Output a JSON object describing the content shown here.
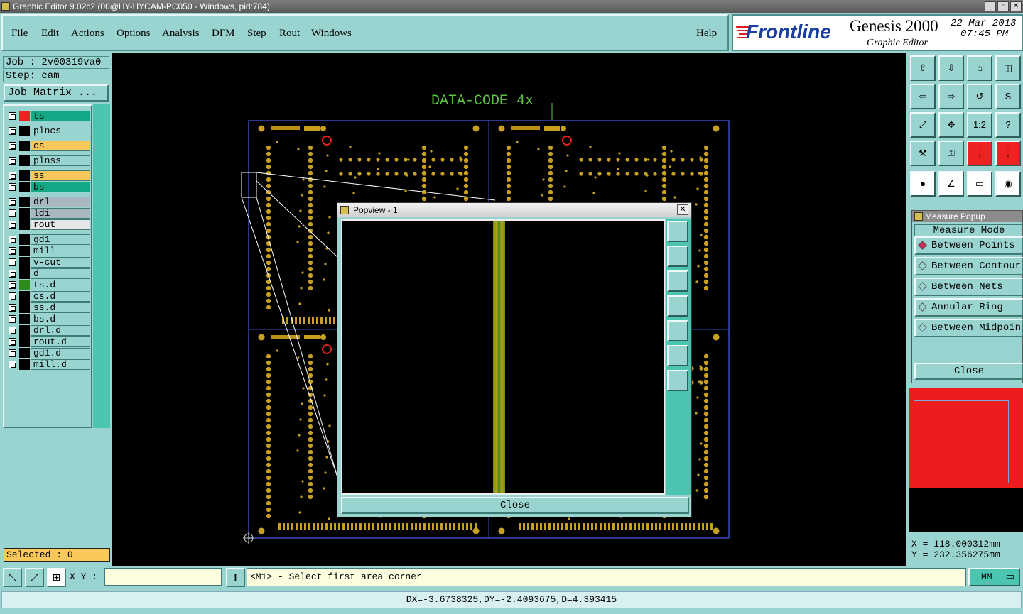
{
  "window": {
    "title": "Graphic Editor 9.02c2 (00@HY-HYCAM-PC050 - Windows, pid:784)"
  },
  "menu": [
    "File",
    "Edit",
    "Actions",
    "Options",
    "Analysis",
    "DFM",
    "Step",
    "Rout",
    "Windows"
  ],
  "help_label": "Help",
  "brand": {
    "logo": "Frontline",
    "product": "Genesis 2000",
    "subtitle": "Graphic Editor",
    "date": "22 Mar 2013",
    "time": "07:45 PM"
  },
  "job": {
    "job_line": "Job : 2v00319va0",
    "step_line": "Step: cam",
    "matrix_button": "Job Matrix ..."
  },
  "layers": [
    {
      "name": "ts",
      "color": "#13a886",
      "swatch": "#ee2222"
    },
    {
      "name": "plncs",
      "color": "#9ad4d0",
      "swatch": "#000000"
    },
    {
      "name": "cs",
      "color": "#f8c85a",
      "swatch": "#000000"
    },
    {
      "name": "plnss",
      "color": "#9ad4d0",
      "swatch": "#000000"
    },
    {
      "name": "ss",
      "color": "#f8c85a",
      "swatch": "#000000"
    },
    {
      "name": "bs",
      "color": "#13a886",
      "swatch": "#000000"
    },
    {
      "name": "drl",
      "color": "#a8b8c0",
      "swatch": "#000000"
    },
    {
      "name": "ldi",
      "color": "#a8b8c0",
      "swatch": "#000000"
    },
    {
      "name": "rout",
      "color": "#e6e6e6",
      "swatch": "#000000"
    },
    {
      "name": "gd1",
      "color": "#9ad4d0",
      "swatch": "#000000"
    },
    {
      "name": "mill",
      "color": "#9ad4d0",
      "swatch": "#000000"
    },
    {
      "name": "v-cut",
      "color": "#9ad4d0",
      "swatch": "#000000"
    },
    {
      "name": "d",
      "color": "#9ad4d0",
      "swatch": "#000000"
    },
    {
      "name": "ts.d",
      "color": "#9ad4d0",
      "swatch": "#2e8b1e"
    },
    {
      "name": "cs.d",
      "color": "#9ad4d0",
      "swatch": "#000000"
    },
    {
      "name": "ss.d",
      "color": "#9ad4d0",
      "swatch": "#000000"
    },
    {
      "name": "bs.d",
      "color": "#9ad4d0",
      "swatch": "#000000"
    },
    {
      "name": "drl.d",
      "color": "#9ad4d0",
      "swatch": "#000000"
    },
    {
      "name": "rout.d",
      "color": "#9ad4d0",
      "swatch": "#000000"
    },
    {
      "name": "gd1.d",
      "color": "#9ad4d0",
      "swatch": "#000000"
    },
    {
      "name": "mill.d",
      "color": "#9ad4d0",
      "swatch": "#000000"
    }
  ],
  "selected": "Selected : 0",
  "canvas": {
    "annotation": "DATA-CODE 4x"
  },
  "popview": {
    "title": "Popview - 1",
    "close_label": "Close"
  },
  "measure": {
    "title": "Measure Popup",
    "mode_label": "Measure Mode",
    "options": [
      "Between Points",
      "Between Contours",
      "Between Nets",
      "Annular Ring",
      "Between Midpoints"
    ],
    "selected_option": "Between Points",
    "close_label": "Close"
  },
  "coords": {
    "x": "X  = 118.000312mm",
    "y": "Y  = 232.356275mm"
  },
  "bottom": {
    "xy_label": "X Y :",
    "xy_value": "",
    "prompt": "<M1> - Select first area corner",
    "units": "MM"
  },
  "status": "DX=-3.6738325,DY=-2.4093675,D=4.393415",
  "colors": {
    "panel": "#9ad4d0",
    "pad": "#c8a020",
    "accent_red": "#ee1c1c"
  }
}
